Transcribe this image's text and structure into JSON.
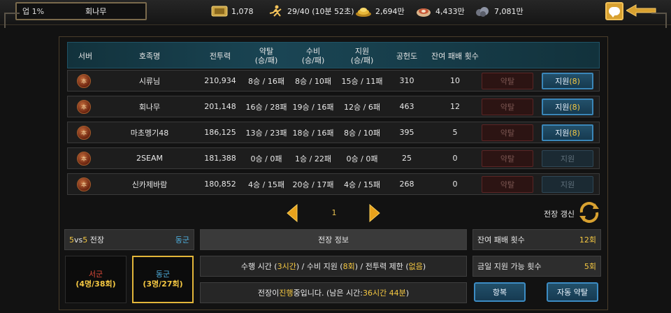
{
  "player": {
    "level": "업 1%",
    "name": "회나무"
  },
  "resources": [
    {
      "icon": "ticket-scroll-icon",
      "value": "1,078"
    },
    {
      "icon": "running-man-stamina-icon",
      "value": "29/40 (10분 52초)"
    },
    {
      "icon": "gold-pile-icon",
      "value": "2,694만"
    },
    {
      "icon": "food-meat-icon",
      "value": "4,433만"
    },
    {
      "icon": "ore-stone-icon",
      "value": "7,081만"
    }
  ],
  "table": {
    "headers": {
      "server": "서버",
      "clan": "호족명",
      "power": "전투력",
      "plunder1": "약탈",
      "plunder2": "(승/패)",
      "defense1": "수비",
      "defense2": "(승/패)",
      "support1": "지원",
      "support2": "(승/패)",
      "contribution": "공헌도",
      "remaining": "잔여 패배 횟수"
    },
    "rows": [
      {
        "server_mark": "本",
        "clan": "시류님",
        "power": "210,934",
        "plunder": "8승 / 16패",
        "defense": "8승 / 10패",
        "support": "15승 / 11패",
        "contribution": "310",
        "remaining": "10",
        "plunder_btn": "약탈",
        "support_btn": "지원",
        "support_count": "(8)"
      },
      {
        "server_mark": "本",
        "clan": "회나무",
        "power": "201,148",
        "plunder": "16승 / 28패",
        "defense": "19승 / 16패",
        "support": "12승 / 6패",
        "contribution": "463",
        "remaining": "12",
        "plunder_btn": "약탈",
        "support_btn": "지원",
        "support_count": "(8)"
      },
      {
        "server_mark": "本",
        "clan": "마초멩기48",
        "power": "186,125",
        "plunder": "13승 / 23패",
        "defense": "18승 / 16패",
        "support": "8승 / 10패",
        "contribution": "395",
        "remaining": "5",
        "plunder_btn": "약탈",
        "support_btn": "지원",
        "support_count": "(8)"
      },
      {
        "server_mark": "本",
        "clan": "2SEAM",
        "power": "181,388",
        "plunder": "0승 / 0패",
        "defense": "1승 / 22패",
        "support": "0승 / 0패",
        "contribution": "25",
        "remaining": "0",
        "plunder_btn": "약탈",
        "support_btn": "지원",
        "support_count": ""
      },
      {
        "server_mark": "本",
        "clan": "신카제바람",
        "power": "180,852",
        "plunder": "4승 / 15패",
        "defense": "20승 / 17패",
        "support": "4승 / 15패",
        "contribution": "268",
        "remaining": "0",
        "plunder_btn": "약탈",
        "support_btn": "지원",
        "support_count": ""
      }
    ]
  },
  "pager": {
    "page": "1"
  },
  "refresh_label": "전장 갱신",
  "mode": {
    "size_a": "5",
    "vs": "vs",
    "size_b": "5",
    "label": " 전장",
    "faction": "동군"
  },
  "sides": {
    "west": {
      "title": "서군",
      "stats": "(4명/38회)"
    },
    "east": {
      "title": "동군",
      "stats": "(3명/27회)"
    }
  },
  "info": {
    "header": "전장 정보",
    "line1_a": "수행 시간 (",
    "line1_b": "3시간",
    "line1_c": ") / 수비 지원 (",
    "line1_d": "8회",
    "line1_e": ") / 전투력 제한 (",
    "line1_f": "없음",
    "line1_g": ")",
    "line2_a": "전장이 ",
    "line2_b": "진행",
    "line2_c": "중입니다. (남은 시간: ",
    "line2_d": "36시간 44분",
    "line2_e": ")"
  },
  "stats": {
    "remaining_label": "잔여 패배 횟수",
    "remaining_value": "12회",
    "support_label": "금일 지원 가능 횟수",
    "support_value": "5회"
  },
  "buttons": {
    "surrender": "항복",
    "auto_plunder": "자동 약탈"
  },
  "colors": {
    "accent_gold": "#f5c842",
    "east_blue": "#4fb0e0",
    "west_red": "#e24b3a"
  }
}
